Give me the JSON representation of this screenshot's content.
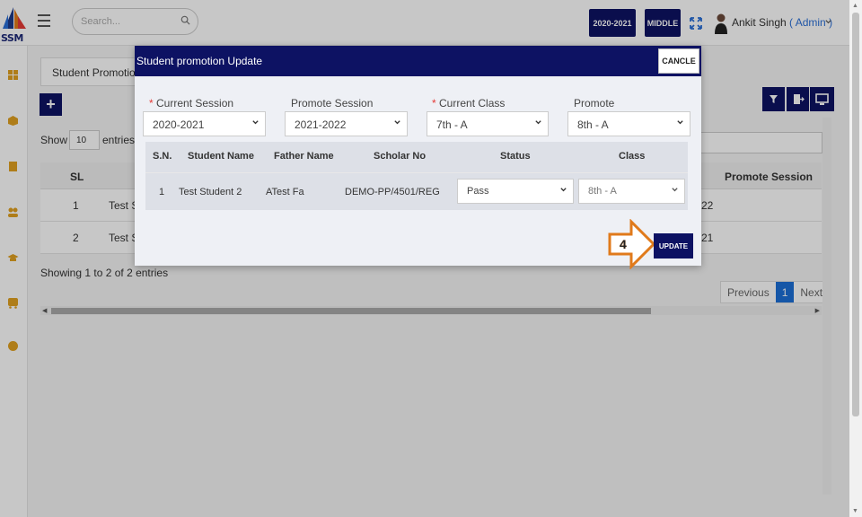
{
  "header": {
    "logo_text": "SSM",
    "search_placeholder": "Search...",
    "session_button": "2020-2021",
    "level_button": "MIDDLE",
    "user_name": "Ankit Singh",
    "user_role": "( Admin )"
  },
  "page": {
    "tab_label": "Student Promotion",
    "show_label": "Show",
    "entries_value": "10",
    "entries_label": "entries",
    "table": {
      "col_sl": "SL",
      "col_promote_session": "Promote Session",
      "rows": [
        {
          "sl": "1",
          "name": "Test S",
          "session": "22"
        },
        {
          "sl": "2",
          "name": "Test S",
          "session": "21"
        }
      ]
    },
    "showing_text": "Showing 1 to 2 of 2 entries",
    "pager": {
      "previous": "Previous",
      "current": "1",
      "next": "Next"
    }
  },
  "modal": {
    "title": "Student promotion Update",
    "cancel_label": "CANCLE",
    "fields": {
      "current_session": {
        "label": "Current Session",
        "value": "2020-2021"
      },
      "promote_session": {
        "label": "Promote Session",
        "value": "2021-2022"
      },
      "current_class": {
        "label": "Current Class",
        "value": "7th - A"
      },
      "promote": {
        "label": "Promote",
        "value": "8th - A"
      }
    },
    "grid": {
      "headers": {
        "sn": "S.N.",
        "student_name": "Student Name",
        "father_name": "Father Name",
        "scholar_no": "Scholar No",
        "status": "Status",
        "class": "Class"
      },
      "row": {
        "sn": "1",
        "student_name": "Test Student 2",
        "father_name": "ATest Fa",
        "scholar_no": "DEMO-PP/4501/REG",
        "status": "Pass",
        "class": "8th - A"
      }
    },
    "update_label": "UPDATE",
    "step_number": "4"
  },
  "colors": {
    "primary": "#0d1263",
    "accent_blue": "#2a6fd6",
    "annotation_orange": "#e07a1b",
    "required_red": "#e53935"
  }
}
